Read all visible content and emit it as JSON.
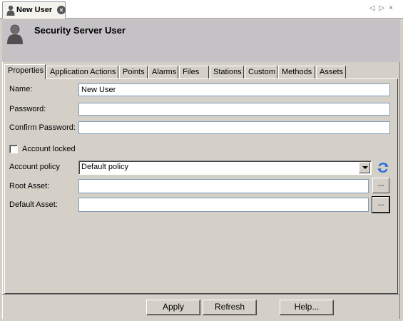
{
  "tab": {
    "label": "New User",
    "close": "×"
  },
  "nav": {
    "left": "◁",
    "right": "▷",
    "close": "×"
  },
  "header": {
    "title": "Security Server User"
  },
  "tabs": [
    {
      "label": "Properties"
    },
    {
      "label": "Application Actions"
    },
    {
      "label": "Points"
    },
    {
      "label": "Alarms"
    },
    {
      "label": "Files"
    },
    {
      "label": "Stations"
    },
    {
      "label": "Custom"
    },
    {
      "label": "Methods"
    },
    {
      "label": "Assets"
    }
  ],
  "form": {
    "name_label": "Name:",
    "name_value": "New User",
    "password_label": "Password:",
    "password_value": "",
    "confirm_label": "Confirm Password:",
    "confirm_value": "",
    "account_locked_label": "Account locked",
    "account_locked_checked": false,
    "policy_label": "Account policy",
    "policy_value": "Default policy",
    "root_asset_label": "Root Asset:",
    "root_asset_value": "",
    "default_asset_label": "Default Asset:",
    "default_asset_value": "",
    "browse_label": "..."
  },
  "buttons": {
    "apply": "Apply",
    "refresh": "Refresh",
    "help": "Help..."
  },
  "colors": {
    "background": "#d4d0c8",
    "header": "#c4c2c5",
    "refresh_icon": "#2a6fd6"
  }
}
